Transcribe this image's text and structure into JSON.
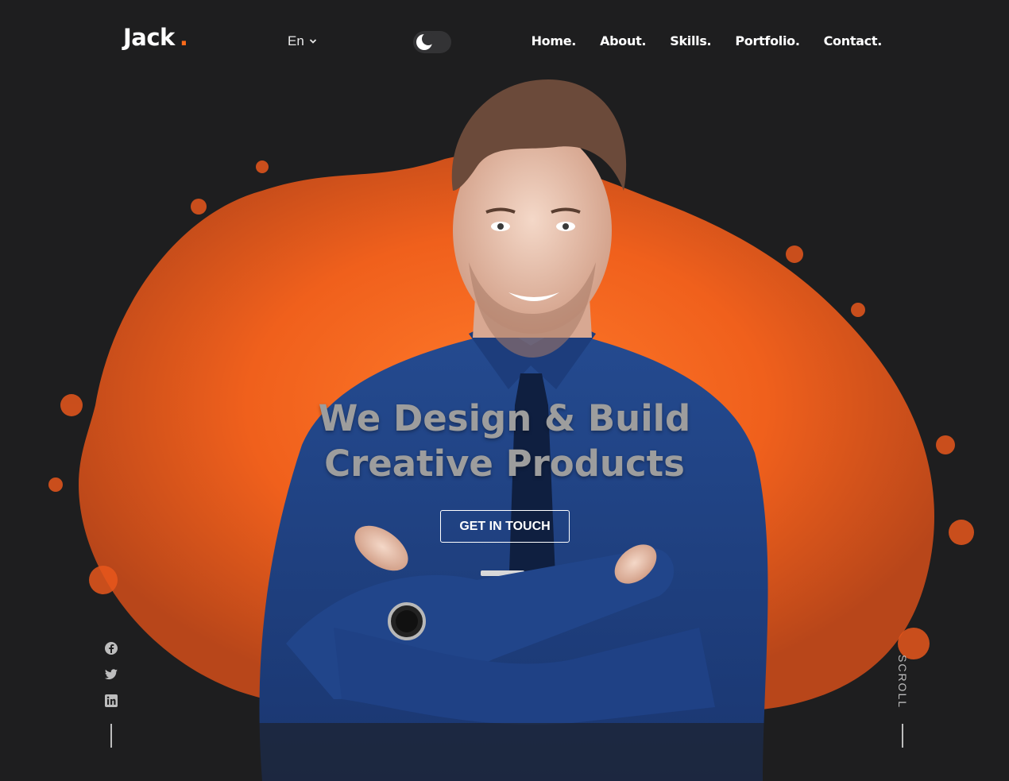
{
  "header": {
    "logo": "Jack",
    "logo_dot": ".",
    "language": "En",
    "nav": [
      "Home.",
      "About.",
      "Skills.",
      "Portfolio.",
      "Contact."
    ]
  },
  "hero": {
    "headline_line1": "We Design & Build",
    "headline_line2": "Creative Products",
    "cta_label": "GET IN TOUCH"
  },
  "social": [
    "facebook-icon",
    "twitter-icon",
    "linkedin-icon"
  ],
  "scroll_label": "SCROLL",
  "colors": {
    "background": "#1e1e1f",
    "accent": "#ff6b1a",
    "shirt": "#1d3b78",
    "headline": "#9d9d9d"
  }
}
